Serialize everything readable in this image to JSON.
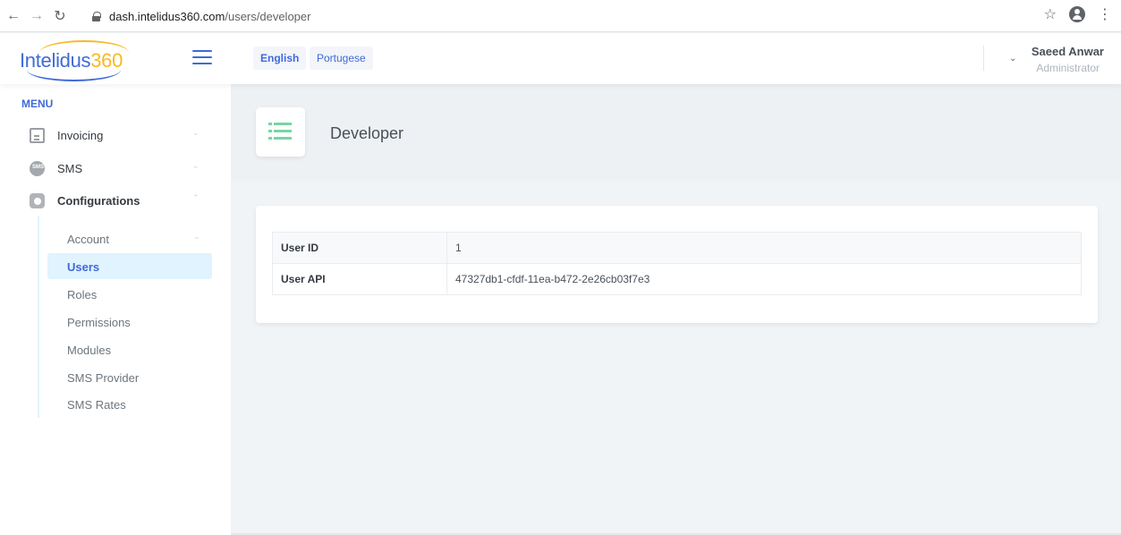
{
  "browser": {
    "url_host": "dash.intelidus360.com",
    "url_path": "/users/developer"
  },
  "header": {
    "logo_text_primary": "Intelidus",
    "logo_text_accent": "360",
    "languages": [
      "English",
      "Portugese"
    ],
    "user_name": "Saeed Anwar",
    "user_role": "Administrator"
  },
  "sidebar": {
    "heading": "MENU",
    "items": [
      {
        "label": "Invoicing",
        "icon": "document-icon"
      },
      {
        "label": "SMS",
        "icon": "sms-icon"
      },
      {
        "label": "Configurations",
        "icon": "gear-icon"
      }
    ],
    "submenu": [
      {
        "label": "Account"
      },
      {
        "label": "Users",
        "active": true
      },
      {
        "label": "Roles"
      },
      {
        "label": "Permissions"
      },
      {
        "label": "Modules"
      },
      {
        "label": "SMS Provider"
      },
      {
        "label": "SMS Rates"
      }
    ]
  },
  "page": {
    "title": "Developer"
  },
  "details": {
    "rows": [
      {
        "key": "User ID",
        "value": "1"
      },
      {
        "key": "User API",
        "value": "47327db1-cfdf-11ea-b472-2e26cb03f7e3"
      }
    ]
  },
  "colors": {
    "primary": "#3f6ad8",
    "accent": "#f7b924",
    "success": "#3ac47d",
    "active_bg": "#e0f3ff"
  }
}
